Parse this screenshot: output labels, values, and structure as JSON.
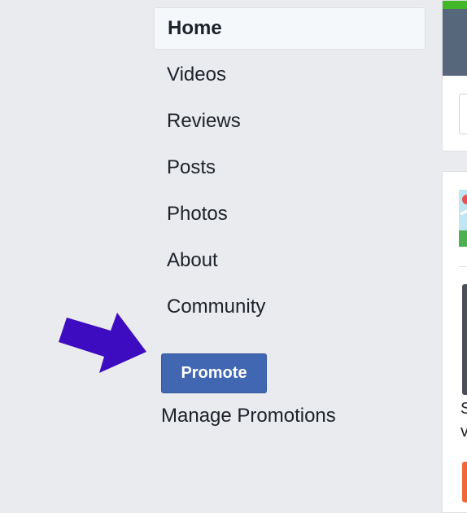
{
  "nav": {
    "items": [
      {
        "label": "Home",
        "active": true
      },
      {
        "label": "Videos",
        "active": false
      },
      {
        "label": "Reviews",
        "active": false
      },
      {
        "label": "Posts",
        "active": false
      },
      {
        "label": "Photos",
        "active": false
      },
      {
        "label": "About",
        "active": false
      },
      {
        "label": "Community",
        "active": false
      }
    ]
  },
  "promote": {
    "button_label": "Promote",
    "manage_label": "Manage Promotions"
  },
  "annotation": {
    "arrow_color": "#3d0cc0",
    "arrow_icon": "arrow-right-icon"
  },
  "right_panel": {
    "peek_line1": "S",
    "peek_line2": "v"
  },
  "colors": {
    "accent": "#4267b2",
    "background": "#e9ebee",
    "cover_green": "#42b72a",
    "orange": "#f0683a"
  }
}
